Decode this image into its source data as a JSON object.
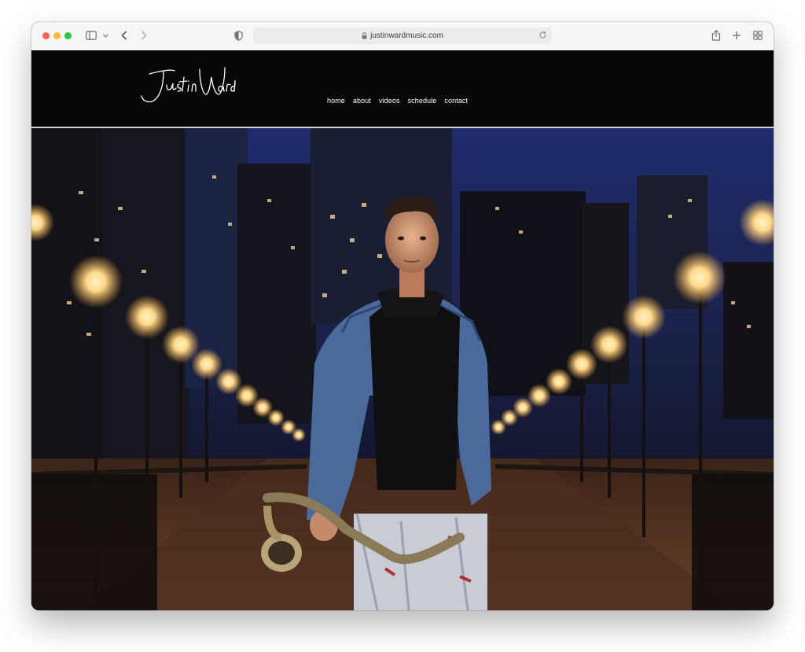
{
  "browser": {
    "url": "justinwardmusic.com",
    "icons": {
      "sidebar": "sidebar-icon",
      "sidebar_menu": "chevron-down-icon",
      "back": "back-arrow-icon",
      "forward": "forward-arrow-icon",
      "privacy": "shield-icon",
      "lock": "lock-icon",
      "reload": "reload-icon",
      "share": "share-icon",
      "new_tab": "plus-icon",
      "tabs": "tab-grid-icon"
    }
  },
  "site": {
    "logo_text": "Justin Ward",
    "nav": [
      {
        "label": "home"
      },
      {
        "label": "about"
      },
      {
        "label": "videos"
      },
      {
        "label": "schedule"
      },
      {
        "label": "contact"
      }
    ]
  },
  "colors": {
    "header_bg": "#080607",
    "nav_text": "#ffffff",
    "sky": "#232f6e",
    "lamp_glow": "#ffd98a"
  }
}
